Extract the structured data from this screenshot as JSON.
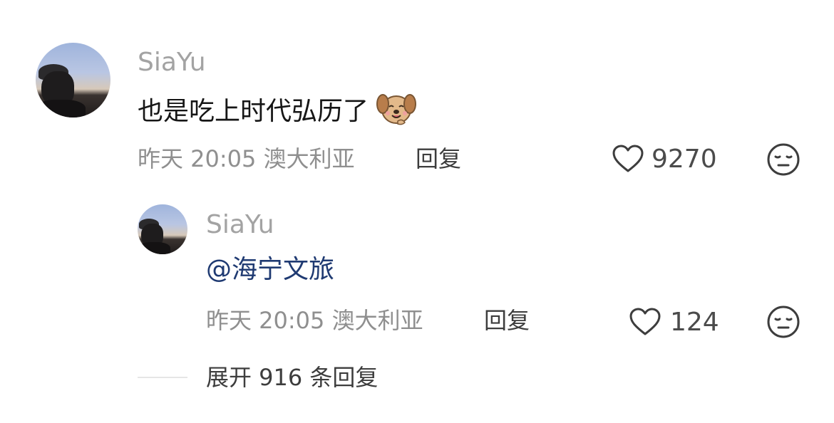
{
  "comment": {
    "username": "SiaYu",
    "text": "也是吃上时代弘历了",
    "emoji": "dog-face-sticker",
    "meta": "昨天 20:05 澳大利亚",
    "reply_label": "回复",
    "likes": "9270"
  },
  "reply": {
    "username": "SiaYu",
    "mention": "@海宁文旅",
    "meta": "昨天 20:05 澳大利亚",
    "reply_label": "回复",
    "likes": "124"
  },
  "expand": {
    "label": "展开 916 条回复"
  },
  "colors": {
    "username": "#a3a3a3",
    "mention": "#1f3a72",
    "meta": "#8f8f8f"
  }
}
